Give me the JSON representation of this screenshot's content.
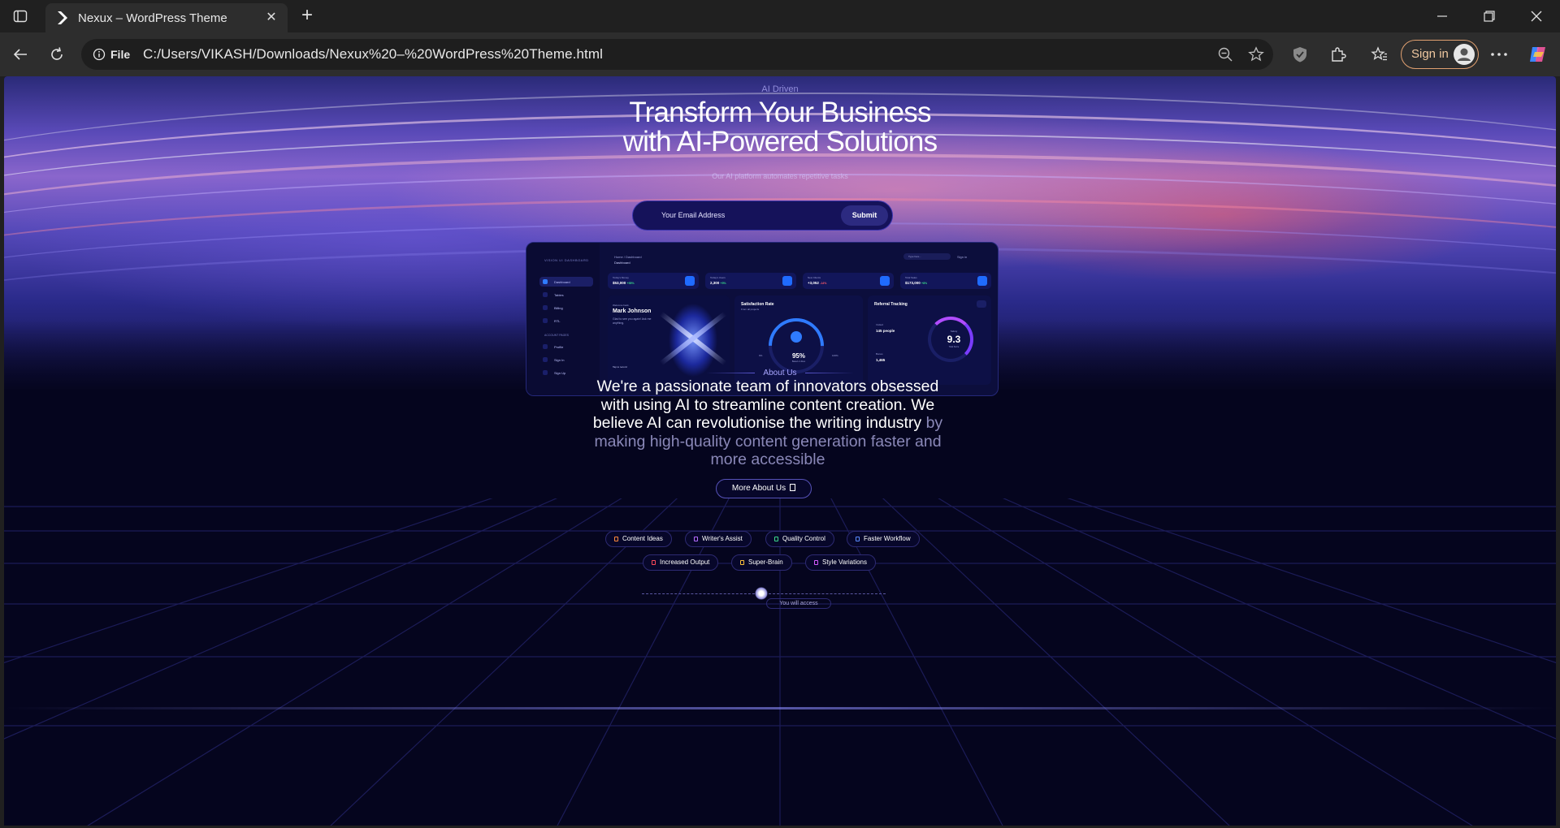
{
  "browser": {
    "tab_title": "Nexux – WordPress Theme",
    "url": "C:/Users/VIKASH/Downloads/Nexux%20–%20WordPress%20Theme.html",
    "info_label": "File",
    "signin_label": "Sign in"
  },
  "hero": {
    "eyebrow": "AI Driven",
    "title_line1": "Transform Your Business",
    "title_line2": "with AI-Powered Solutions",
    "subtitle": "Our AI platform automates repetitive tasks",
    "email_placeholder": "Your Email Address",
    "submit_label": "Submit"
  },
  "dashboard": {
    "brand": "VISION UI DASHBOARD",
    "breadcrumb": "Home / Dashboard",
    "page_title": "Dashboard",
    "search_placeholder": "Type here...",
    "topbar_signin": "Sign in",
    "nav": [
      {
        "label": "Dashboard"
      },
      {
        "label": "Tables"
      },
      {
        "label": "Billing"
      },
      {
        "label": "RTL"
      }
    ],
    "account_section": "ACCOUNT PAGES",
    "account_nav": [
      {
        "label": "Profile"
      },
      {
        "label": "Sign In"
      },
      {
        "label": "Sign Up"
      }
    ],
    "cards": [
      {
        "label": "Today's Money",
        "value": "$53,000",
        "delta": "+55%"
      },
      {
        "label": "Today's Users",
        "value": "2,300",
        "delta": "+5%"
      },
      {
        "label": "New Clients",
        "value": "+3,052",
        "delta": "-14%"
      },
      {
        "label": "Total Sales",
        "value": "$173,000",
        "delta": "+8%"
      }
    ],
    "welcome": {
      "greeting": "Welcome back,",
      "name": "Mark Johnson",
      "message": "Glad to see you again! Ask me anything.",
      "tap": "Tap to record"
    },
    "satisfaction": {
      "title": "Satisfaction Rate",
      "subtitle": "From all projects",
      "low": "0%",
      "high": "100%",
      "value": "95%",
      "caption": "Based on likes"
    },
    "referral": {
      "title": "Referral Tracking",
      "invited_label": "Invited",
      "invited_value": "145 people",
      "bonus_label": "Bonus",
      "bonus_value": "1,465",
      "score_label": "Safety",
      "score_value": "9.3",
      "score_caption": "Total Score"
    }
  },
  "about": {
    "label": "About Us",
    "text_bright": "We're a passionate team of innovators obsessed with using AI to streamline content creation. We believe AI can revolutionise the writing industry",
    "text_dim": "by making high-quality content generation faster and more accessible",
    "more_label": "More About Us"
  },
  "features": [
    {
      "label": "Content Ideas",
      "color": "#ff8a3c"
    },
    {
      "label": "Writer's Assist",
      "color": "#b66bff"
    },
    {
      "label": "Quality Control",
      "color": "#3cd98a"
    },
    {
      "label": "Faster Workflow",
      "color": "#5a8bff"
    },
    {
      "label": "Increased Output",
      "color": "#ff4a5a"
    },
    {
      "label": "Super-Brain",
      "color": "#ffc23c"
    },
    {
      "label": "Style Variations",
      "color": "#d45aff"
    }
  ],
  "access_label": "You will access"
}
